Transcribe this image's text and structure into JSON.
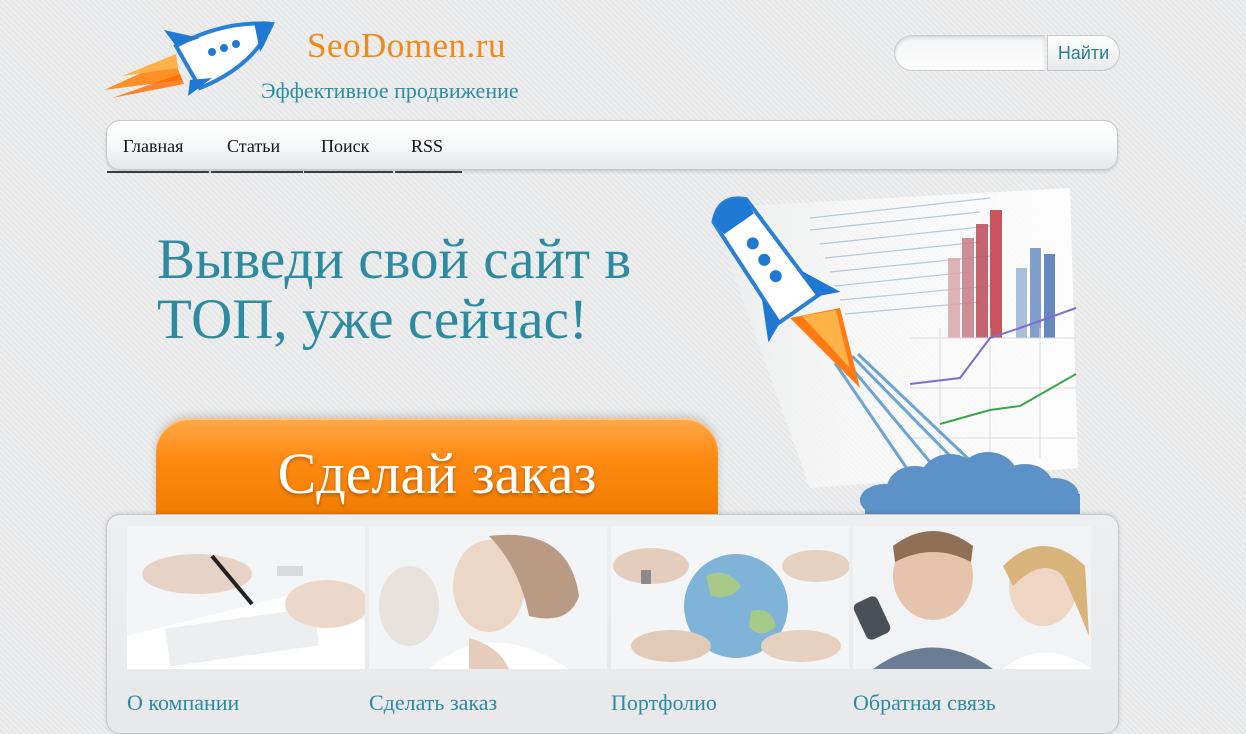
{
  "header": {
    "site_title": "SeoDomen.ru",
    "tagline": "Эффективное продвижение",
    "logo_icon": "rocket-logo"
  },
  "search": {
    "placeholder": "",
    "value": "",
    "button_label": "Найти"
  },
  "nav": {
    "items": [
      {
        "label": "Главная"
      },
      {
        "label": "Статьи"
      },
      {
        "label": "Поиск"
      },
      {
        "label": "RSS"
      }
    ]
  },
  "hero": {
    "headline_line1": "Выведи свой сайт в",
    "headline_line2": "ТОП, уже сейчас!",
    "cta_label": "Сделай заказ",
    "accent_color": "#ff8b14",
    "text_color": "#2d8aa0"
  },
  "tiles": [
    {
      "caption": "О компании",
      "image": "handshake-document-photo"
    },
    {
      "caption": "Сделать заказ",
      "image": "woman-looking-up-photo"
    },
    {
      "caption": "Портфолио",
      "image": "hands-holding-globe-photo"
    },
    {
      "caption": "Обратная связь",
      "image": "people-on-phone-photo"
    }
  ]
}
